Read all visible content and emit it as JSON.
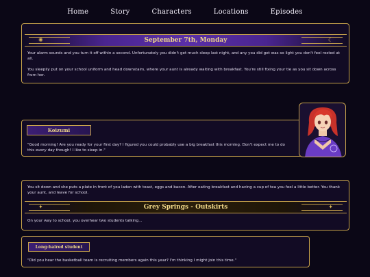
{
  "nav": {
    "items": [
      "Home",
      "Story",
      "Characters",
      "Locations",
      "Episodes"
    ]
  },
  "scene1": {
    "date_title": "September 7th, Monday",
    "paragraph1": "Your alarm sounds and you turn it off within a second. Unfortunately you didn't get much sleep last night, and any you did get was so light you don't feel rested at all.",
    "paragraph2": "You sleepily put on your school uniform and head downstairs, where your aunt is already waiting with breakfast. You're still fixing your tie as you sit down across from her."
  },
  "dialogue1": {
    "speaker": "Koizumi",
    "text": "\"Good morning! Are you ready for your first day? I figured you could probably use a big breakfast this morning. Don't expect me to do this every day though! I like to sleep in.\""
  },
  "scene2": {
    "paragraph1": "You sit down and she puts a plate in front of you laden with toast, eggs and bacon. After eating breakfast and having a cup of tea you feel a little better. You thank your aunt, and leave for school.",
    "location_title": "Grey Springs - Outskirts",
    "paragraph2": "On your way to school, you overhear two students talking..."
  },
  "dialogue2": {
    "speaker": "Long-haired student",
    "text": "\"Did you hear the basketball team is recruiting members again this year? I'm thinking I might join this time.\""
  },
  "colors": {
    "gold": "#c9a44c",
    "purple_banner": "#4a2590",
    "background": "#0b0716"
  }
}
